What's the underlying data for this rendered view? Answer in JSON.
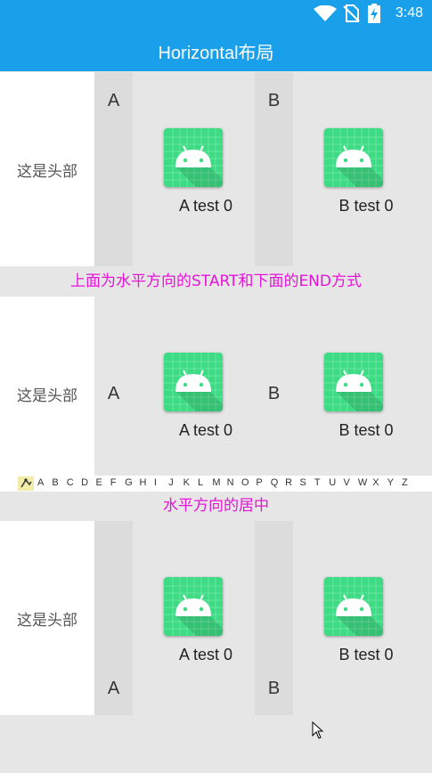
{
  "status_bar": {
    "time": "3:48"
  },
  "app_bar": {
    "title": "Horizontal布局"
  },
  "sections": [
    {
      "header": "这是头部",
      "letters": [
        "A",
        "B"
      ],
      "items": [
        "A test 0",
        "B test 0"
      ]
    },
    {
      "header": "这是头部",
      "letters": [
        "A",
        "B"
      ],
      "items": [
        "A test 0",
        "B test 0"
      ]
    },
    {
      "header": "这是头部",
      "letters": [
        "A",
        "B"
      ],
      "items": [
        "A test 0",
        "B test 0"
      ]
    }
  ],
  "dividers": [
    "上面为水平方向的START和下面的END方式",
    "水平方向的居中"
  ],
  "index_letters": [
    "A",
    "B",
    "C",
    "D",
    "E",
    "F",
    "G",
    "H",
    "I",
    "J",
    "K",
    "L",
    "M",
    "N",
    "O",
    "P",
    "Q",
    "R",
    "S",
    "T",
    "U",
    "V",
    "W",
    "X",
    "Y",
    "Z"
  ],
  "colors": {
    "accent": "#1aa0ea",
    "divider_text": "#e514d8",
    "icon_bg": "#3ddc84"
  },
  "icons": [
    "wifi-icon",
    "sim-off-icon",
    "battery-charging-icon",
    "android-icon",
    "mouse-cursor-icon"
  ]
}
